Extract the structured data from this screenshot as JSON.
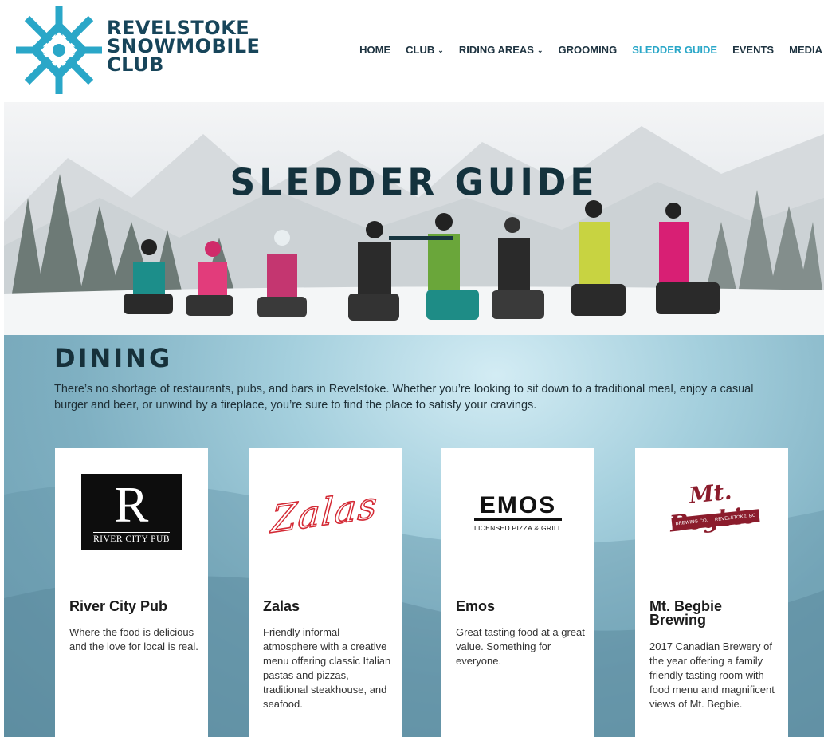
{
  "logo": {
    "line1": "REVELSTOKE",
    "line2": "SNOWMOBILE",
    "line3": "CLUB",
    "icon": "snowflake-logo-icon",
    "color": "#2aa7c8"
  },
  "nav": {
    "items": [
      {
        "label": "HOME",
        "dropdown": false
      },
      {
        "label": "CLUB",
        "dropdown": true
      },
      {
        "label": "RIDING AREAS",
        "dropdown": true
      },
      {
        "label": "GROOMING",
        "dropdown": false
      },
      {
        "label": "SLEDDER GUIDE",
        "dropdown": false,
        "active": true
      },
      {
        "label": "EVENTS",
        "dropdown": false
      },
      {
        "label": "MEDIA",
        "dropdown": false
      }
    ],
    "chevron": "⌄",
    "active_color": "#2aa7c8"
  },
  "hero": {
    "title": "SLEDDER GUIDE"
  },
  "dining": {
    "title": "DINING",
    "description": "There’s no shortage of restaurants, pubs, and bars in Revelstoke. Whether you’re looking to sit down to a traditional meal, enjoy a casual burger and beer, or unwind by a fireplace, you’re sure to find the place to satisfy your cravings.",
    "cards": [
      {
        "name": "River City Pub",
        "description": "Where the food is delicious and the love for local is real.",
        "logo_mark": "R",
        "logo_text": "RIVER CITY PUB"
      },
      {
        "name": "Zalas",
        "description": "Friendly informal atmosphere with a creative menu offering classic Italian pastas and pizzas, traditional steakhouse, and seafood.",
        "logo_text": "Zalas"
      },
      {
        "name": "Emos",
        "description": "Great tasting food at a great value.  Something for everyone.",
        "logo_text": "EMOS",
        "logo_subtext": "LICENSED PIZZA & GRILL"
      },
      {
        "name": "Mt. Begbie Brewing",
        "description": "2017 Canadian Brewery of the year offering a family friendly tasting room with food menu and magnificent views of Mt. Begbie.",
        "logo_text": "Mt. Begbie",
        "logo_ribbon_left": "BREWING CO.",
        "logo_ribbon_right": "REVELSTOKE, BC"
      }
    ]
  }
}
